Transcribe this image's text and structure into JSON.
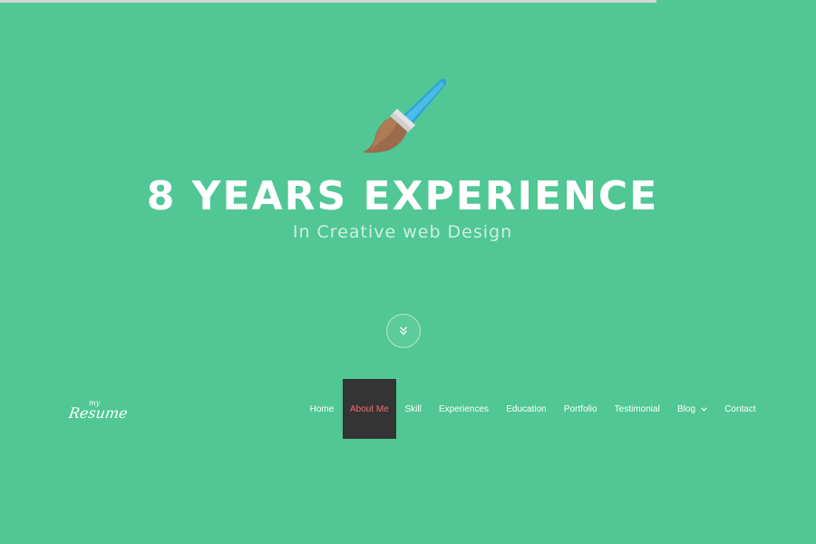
{
  "hero": {
    "title": "8 YEARS EXPERIENCE",
    "subtitle": "In Creative web Design",
    "icon": "paint-brush-icon",
    "scroll_icon": "double-chevron-down-icon"
  },
  "navbar": {
    "logo_small": "my",
    "logo_main": "Resume",
    "items": [
      {
        "label": "Home"
      },
      {
        "label": "About Me",
        "active": true
      },
      {
        "label": "Skill"
      },
      {
        "label": "Experiences"
      },
      {
        "label": "Education"
      },
      {
        "label": "Portfolio"
      },
      {
        "label": "Testimonial"
      },
      {
        "label": "Blog",
        "has_dropdown": true,
        "icon": "chevron-down-icon"
      },
      {
        "label": "Contact"
      }
    ]
  },
  "colors": {
    "background": "#50c794",
    "active_bg": "#343434",
    "active_text": "#f26b6b"
  }
}
